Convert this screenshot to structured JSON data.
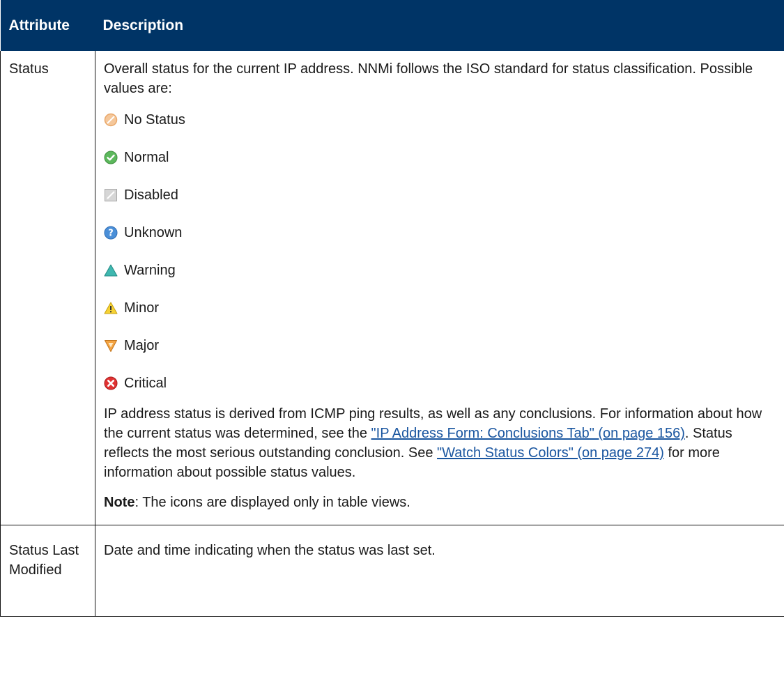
{
  "table": {
    "headers": {
      "attribute": "Attribute",
      "description": "Description"
    },
    "rows": [
      {
        "attribute": "Status",
        "intro": "Overall status for the current IP address. NNMi follows the ISO standard for status classification. Possible values are:",
        "status_values": [
          {
            "label": "No Status",
            "icon": "no-status-icon"
          },
          {
            "label": "Normal",
            "icon": "normal-icon"
          },
          {
            "label": "Disabled",
            "icon": "disabled-icon"
          },
          {
            "label": "Unknown",
            "icon": "unknown-icon"
          },
          {
            "label": "Warning",
            "icon": "warning-icon"
          },
          {
            "label": "Minor",
            "icon": "minor-icon"
          },
          {
            "label": "Major",
            "icon": "major-icon"
          },
          {
            "label": "Critical",
            "icon": "critical-icon"
          }
        ],
        "body": {
          "text1": "IP address status is derived from ICMP ping results, as well as any conclusions. For information about how the current status was determined, see the ",
          "link1": "\"IP Address Form: Conclusions Tab\" (on page 156)",
          "text2": ". Status reflects the most serious outstanding conclusion. See ",
          "link2": "\"Watch Status Colors\" (on page 274)",
          "text3": " for more information about possible status values."
        },
        "note": {
          "label": "Note",
          "text": ": The icons are displayed only in table views."
        }
      },
      {
        "attribute": "Status Last Modified",
        "description": "Date and time indicating when the status was last set."
      }
    ]
  },
  "colors": {
    "header_bg": "#003466",
    "link": "#1a56a0"
  }
}
